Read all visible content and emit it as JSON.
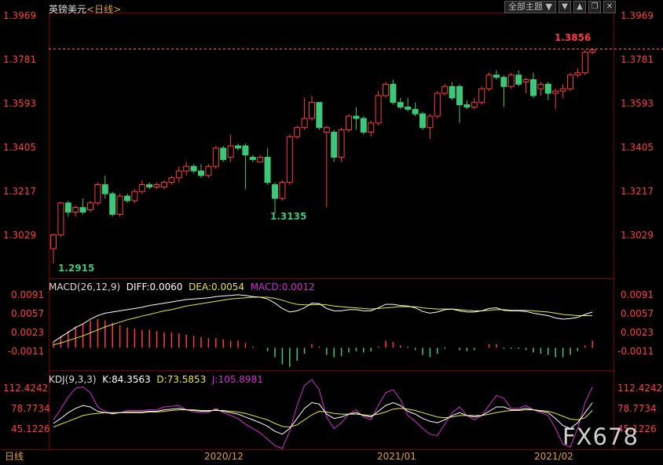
{
  "header": {
    "symbol": "英镑美元",
    "period_label": "<日线>"
  },
  "toolbar": {
    "theme_label": "全部主题",
    "theme_caret": "▼",
    "icons": [
      "arrow-down-icon",
      "arrow-up-icon",
      "restore-icon",
      "close-icon"
    ]
  },
  "footer": {
    "period": "日线"
  },
  "watermark": "FX678",
  "colors": {
    "up": "#ff3c3c",
    "down": "#3cc878",
    "price_axis": "#ff4040",
    "dif": "#ffffff",
    "dea": "#e8e840",
    "j": "#d030d0",
    "grid": "#2a0000"
  },
  "chart_data": [
    {
      "type": "candlestick",
      "title": "英镑美元<日线>",
      "yaxis_ticks": [
        "1.3969",
        "1.3781",
        "1.3593",
        "1.3405",
        "1.3217",
        "1.3029"
      ],
      "ylim": [
        1.286,
        1.4
      ],
      "xaxis_ticks": [
        "2020/12",
        "2021/01",
        "2021/02"
      ],
      "annotations": {
        "high": "1.3856",
        "mid_low": "1.3135",
        "low": "1.2915"
      },
      "candles": [
        [
          1.298,
          1.304,
          1.2915,
          1.3045
        ],
        [
          1.304,
          1.318,
          1.303,
          1.3185
        ],
        [
          1.318,
          1.314,
          1.312,
          1.319
        ],
        [
          1.314,
          1.316,
          1.312,
          1.317
        ],
        [
          1.316,
          1.314,
          1.313,
          1.32
        ],
        [
          1.315,
          1.318,
          1.314,
          1.319
        ],
        [
          1.318,
          1.326,
          1.317,
          1.327
        ],
        [
          1.326,
          1.322,
          1.32,
          1.33
        ],
        [
          1.322,
          1.313,
          1.312,
          1.323
        ],
        [
          1.313,
          1.321,
          1.312,
          1.322
        ],
        [
          1.321,
          1.319,
          1.318,
          1.322
        ],
        [
          1.319,
          1.323,
          1.318,
          1.324
        ],
        [
          1.323,
          1.326,
          1.322,
          1.328
        ],
        [
          1.326,
          1.325,
          1.324,
          1.327
        ],
        [
          1.325,
          1.326,
          1.324,
          1.327
        ],
        [
          1.325,
          1.327,
          1.324,
          1.328
        ],
        [
          1.327,
          1.329,
          1.326,
          1.33
        ],
        [
          1.329,
          1.332,
          1.327,
          1.334
        ],
        [
          1.332,
          1.334,
          1.33,
          1.336
        ],
        [
          1.334,
          1.332,
          1.331,
          1.335
        ],
        [
          1.332,
          1.33,
          1.329,
          1.335
        ],
        [
          1.33,
          1.334,
          1.329,
          1.335
        ],
        [
          1.334,
          1.342,
          1.333,
          1.343
        ],
        [
          1.342,
          1.337,
          1.336,
          1.343
        ],
        [
          1.338,
          1.343,
          1.336,
          1.348
        ],
        [
          1.343,
          1.342,
          1.341,
          1.344
        ],
        [
          1.343,
          1.339,
          1.324,
          1.344
        ],
        [
          1.338,
          1.337,
          1.336,
          1.339
        ],
        [
          1.336,
          1.338,
          1.336,
          1.339
        ],
        [
          1.338,
          1.327,
          1.326,
          1.342
        ],
        [
          1.326,
          1.32,
          1.3135,
          1.327
        ],
        [
          1.32,
          1.327,
          1.319,
          1.328
        ],
        [
          1.327,
          1.347,
          1.326,
          1.348
        ],
        [
          1.347,
          1.351,
          1.346,
          1.352
        ],
        [
          1.351,
          1.355,
          1.35,
          1.364
        ],
        [
          1.355,
          1.362,
          1.354,
          1.365
        ],
        [
          1.362,
          1.351,
          1.35,
          1.362
        ],
        [
          1.349,
          1.351,
          1.316,
          1.352
        ],
        [
          1.349,
          1.338,
          1.336,
          1.35
        ],
        [
          1.338,
          1.35,
          1.336,
          1.351
        ],
        [
          1.35,
          1.356,
          1.349,
          1.357
        ],
        [
          1.356,
          1.355,
          1.35,
          1.36
        ],
        [
          1.355,
          1.349,
          1.348,
          1.356
        ],
        [
          1.349,
          1.353,
          1.347,
          1.354
        ],
        [
          1.353,
          1.365,
          1.352,
          1.367
        ],
        [
          1.365,
          1.37,
          1.364,
          1.371
        ],
        [
          1.37,
          1.362,
          1.361,
          1.372
        ],
        [
          1.362,
          1.36,
          1.359,
          1.364
        ],
        [
          1.36,
          1.359,
          1.358,
          1.364
        ],
        [
          1.359,
          1.357,
          1.356,
          1.362
        ],
        [
          1.357,
          1.351,
          1.35,
          1.358
        ],
        [
          1.351,
          1.356,
          1.346,
          1.357
        ],
        [
          1.356,
          1.366,
          1.355,
          1.367
        ],
        [
          1.366,
          1.369,
          1.365,
          1.37
        ],
        [
          1.369,
          1.364,
          1.363,
          1.371
        ],
        [
          1.369,
          1.361,
          1.353,
          1.37
        ],
        [
          1.361,
          1.36,
          1.359,
          1.363
        ],
        [
          1.36,
          1.362,
          1.359,
          1.364
        ],
        [
          1.362,
          1.368,
          1.361,
          1.369
        ],
        [
          1.368,
          1.374,
          1.367,
          1.375
        ],
        [
          1.374,
          1.373,
          1.372,
          1.376
        ],
        [
          1.373,
          1.369,
          1.36,
          1.374
        ],
        [
          1.369,
          1.374,
          1.368,
          1.375
        ],
        [
          1.374,
          1.37,
          1.369,
          1.376
        ],
        [
          1.371,
          1.372,
          1.366,
          1.373
        ],
        [
          1.372,
          1.365,
          1.364,
          1.375
        ],
        [
          1.368,
          1.37,
          1.365,
          1.371
        ],
        [
          1.37,
          1.366,
          1.363,
          1.371
        ],
        [
          1.366,
          1.367,
          1.359,
          1.368
        ],
        [
          1.367,
          1.368,
          1.364,
          1.37
        ],
        [
          1.368,
          1.374,
          1.367,
          1.375
        ],
        [
          1.374,
          1.375,
          1.373,
          1.377
        ],
        [
          1.375,
          1.384,
          1.374,
          1.385
        ],
        [
          1.384,
          1.385,
          1.383,
          1.3856
        ]
      ]
    },
    {
      "type": "line",
      "title": "MACD(26,12,9)",
      "legend": [
        {
          "name": "DIFF",
          "value": "0.0060"
        },
        {
          "name": "DEA",
          "value": "0.0054"
        },
        {
          "name": "MACD",
          "value": "0.0012"
        }
      ],
      "yaxis_ticks": [
        "0.0091",
        "0.0057",
        "0.0023",
        "-0.0011"
      ],
      "ylim": [
        -0.0035,
        0.011
      ],
      "dif": [
        0.001,
        0.0018,
        0.0026,
        0.0034,
        0.004,
        0.0048,
        0.0054,
        0.0058,
        0.006,
        0.0062,
        0.0064,
        0.0066,
        0.0068,
        0.0071,
        0.0073,
        0.0075,
        0.0077,
        0.0079,
        0.0081,
        0.0082,
        0.0083,
        0.0084,
        0.0086,
        0.0087,
        0.0088,
        0.0089,
        0.0088,
        0.0086,
        0.0085,
        0.0082,
        0.0075,
        0.0066,
        0.006,
        0.0062,
        0.0067,
        0.0075,
        0.0074,
        0.0066,
        0.0062,
        0.0062,
        0.0064,
        0.0064,
        0.0062,
        0.0062,
        0.0067,
        0.0073,
        0.0073,
        0.0071,
        0.007,
        0.0067,
        0.0061,
        0.0058,
        0.006,
        0.0064,
        0.0065,
        0.0062,
        0.006,
        0.006,
        0.0062,
        0.0066,
        0.0067,
        0.0063,
        0.0062,
        0.0062,
        0.0061,
        0.0058,
        0.0056,
        0.0054,
        0.005,
        0.0048,
        0.0049,
        0.0051,
        0.0056,
        0.006
      ],
      "dea": [
        0.0005,
        0.0008,
        0.0012,
        0.0016,
        0.002,
        0.0025,
        0.003,
        0.0035,
        0.0039,
        0.0043,
        0.0047,
        0.005,
        0.0053,
        0.0056,
        0.0059,
        0.0062,
        0.0064,
        0.0067,
        0.007,
        0.0072,
        0.0074,
        0.0076,
        0.0078,
        0.008,
        0.0082,
        0.0083,
        0.0084,
        0.0085,
        0.0085,
        0.0085,
        0.0083,
        0.008,
        0.0076,
        0.0073,
        0.0072,
        0.0072,
        0.0073,
        0.0072,
        0.007,
        0.0069,
        0.0068,
        0.0067,
        0.0066,
        0.0065,
        0.0066,
        0.0067,
        0.0068,
        0.0069,
        0.0069,
        0.0069,
        0.0067,
        0.0066,
        0.0065,
        0.0065,
        0.0065,
        0.0064,
        0.0063,
        0.0062,
        0.0062,
        0.0063,
        0.0064,
        0.0064,
        0.0063,
        0.0063,
        0.0063,
        0.0062,
        0.0061,
        0.006,
        0.0058,
        0.0056,
        0.0055,
        0.0054,
        0.0054,
        0.0054
      ]
    },
    {
      "type": "line",
      "title": "KDJ(9,3,3)",
      "legend": [
        {
          "name": "K",
          "value": "84.3563"
        },
        {
          "name": "D",
          "value": "73.5853"
        },
        {
          "name": "J",
          "value": "105.8981"
        }
      ],
      "yaxis_ticks": [
        "112.4242",
        "78.7734",
        "45.1226"
      ],
      "ylim": [
        20,
        125
      ],
      "k": [
        55,
        62,
        70,
        76,
        80,
        78,
        72,
        70,
        69,
        70,
        71,
        71,
        71,
        72,
        72,
        74,
        75,
        76,
        74,
        73,
        72,
        72,
        74,
        72,
        70,
        68,
        64,
        60,
        56,
        51,
        44,
        40,
        48,
        62,
        76,
        84,
        82,
        68,
        62,
        64,
        68,
        70,
        66,
        64,
        72,
        80,
        84,
        80,
        72,
        68,
        62,
        58,
        56,
        60,
        66,
        70,
        66,
        64,
        66,
        72,
        78,
        78,
        74,
        74,
        76,
        74,
        72,
        70,
        62,
        52,
        48,
        56,
        70,
        84
      ],
      "d": [
        50,
        54,
        58,
        62,
        66,
        68,
        69,
        70,
        70,
        70,
        70,
        70,
        70,
        71,
        71,
        72,
        73,
        74,
        74,
        74,
        73,
        73,
        73,
        73,
        72,
        71,
        69,
        66,
        63,
        60,
        55,
        51,
        50,
        53,
        60,
        67,
        72,
        71,
        69,
        68,
        68,
        68,
        67,
        66,
        68,
        71,
        75,
        76,
        75,
        73,
        70,
        67,
        64,
        63,
        64,
        66,
        66,
        66,
        66,
        68,
        70,
        72,
        73,
        73,
        74,
        74,
        73,
        72,
        69,
        65,
        61,
        60,
        63,
        73
      ],
      "j": [
        60,
        75,
        92,
        104,
        106,
        98,
        78,
        72,
        68,
        70,
        73,
        73,
        73,
        74,
        74,
        78,
        79,
        80,
        74,
        71,
        70,
        70,
        76,
        70,
        66,
        62,
        54,
        48,
        42,
        33,
        24,
        20,
        44,
        80,
        108,
        116,
        102,
        64,
        48,
        56,
        68,
        74,
        64,
        60,
        80,
        98,
        102,
        88,
        66,
        58,
        48,
        40,
        38,
        54,
        70,
        78,
        66,
        60,
        66,
        80,
        94,
        90,
        76,
        76,
        80,
        74,
        70,
        66,
        48,
        26,
        22,
        48,
        84,
        106
      ]
    }
  ]
}
